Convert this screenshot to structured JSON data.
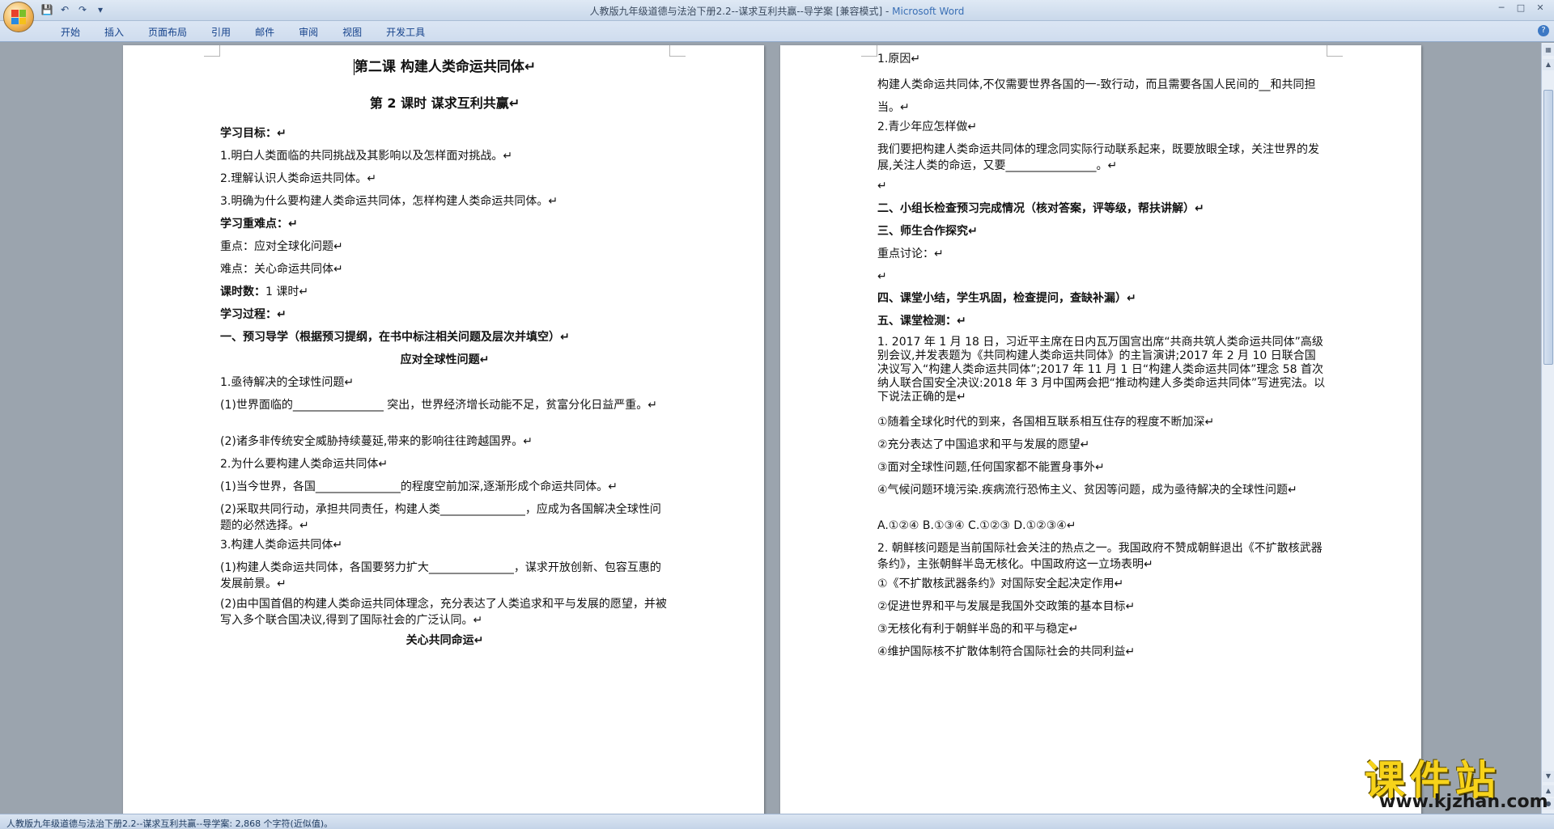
{
  "window": {
    "title": "人教版九年级道德与法治下册2.2--谋求互利共赢--导学案 [兼容模式] - ",
    "app_name": "Microsoft Word"
  },
  "ribbon": {
    "tabs": [
      "开始",
      "插入",
      "页面布局",
      "引用",
      "邮件",
      "审阅",
      "视图",
      "开发工具"
    ]
  },
  "left_page": {
    "lines": [
      "第二课   构建人类命运共同体↵",
      "第 2 课时     谋求互利共赢↵",
      "学习目标：↵",
      "1.明白人类面临的共同挑战及其影响以及怎样面对挑战。↵",
      "2.理解认识人类命运共同体。↵",
      "3.明确为什么要构建人类命运共同体，怎样构建人类命运共同体。↵",
      "学习重难点：↵",
      "重点：应对全球化问题↵",
      "难点：关心命运共同体↵",
      "课时数：",
      "1 课时↵",
      "学习过程：↵",
      "一、预习导学（根据预习提纲，在书中标注相关问题及层次并填空）↵",
      "应对全球性问题↵",
      "1.亟待解决的全球性问题↵",
      "(1)世界面临的________________  突出，世界经济增长动能不足，贫富分化日益严重。↵",
      "(2)诸多非传统安全威胁持续蔓延,带来的影响往往跨越国界。↵",
      "2.为什么要构建人类命运共同体↵",
      "(1)当今世界，各国_______________的程度空前加深,逐渐形成个命运共同体。↵",
      "(2)采取共同行动，承担共同责任，构建人类_______________，应成为各国解决全球性问题的必然选择。↵",
      "3.构建人类命运共同体↵",
      "(1)构建人类命运共同体，各国要努力扩大_______________，谋求开放创新、包容互惠的发展前景。↵",
      "(2)由中国首倡的构建人类命运共同体理念，充分表达了人类追求和平与发展的愿望，并被写入多个联合国决议,得到了国际社会的广泛认同。↵",
      "关心共同命运↵"
    ]
  },
  "right_page": {
    "lines": [
      "1.原因↵",
      "构建人类命运共同体,不仅需要世界各国的一-致行动，而且需要各国人民间的__和共同担当。↵",
      "2.青少年应怎样做↵",
      "我们要把构建人类命运共同体的理念同实际行动联系起来，既要放眼全球，关注世界的发展,关注人类的命运，又要________________。↵",
      "↵",
      "二、小组长检查预习完成情况（核对答案，评等级，帮扶讲解）↵",
      "三、师生合作探究↵",
      "重点讨论：↵",
      "↵",
      "四、课堂小结，学生巩固，检查提问，查缺补漏）↵",
      "五、课堂检测：↵",
      "1. 2017 年 1 月 18 日，习近平主席在日内瓦万国宫出席“共商共筑人类命运共同体”高级别会议,并发表题为《共同构建人类命运共同体》的主旨演讲;2017 年 2 月 10 日联合国决议写入“构建人类命运共同体”;2017 年 11 月 1 日“构建人类命运共同体”理念 58 首次纳人联合国安全决议:2018 年 3 月中国两会把“推动构建人多类命运共同体”写进宪法。以下说法正确的是↵",
      "①随着全球化时代的到来，各国相互联系相互住存的程度不断加深↵",
      "②充分表达了中国追求和平与发展的愿望↵",
      "③面对全球性问题,任何国家都不能置身事外↵",
      "④气候问题环境污染.疾病流行恐怖主义、贫因等问题，成为亟待解决的全球性问题↵",
      "A.①②④      B.①③④      C.①②③    D.①②③④↵",
      "2.  朝鲜核问题是当前国际社会关注的热点之一。我国政府不赞成朝鲜退出《不扩散核武器条约》，主张朝鲜半岛无核化。中国政府这一立场表明↵",
      "①《不扩散核武器条约》对国际安全起决定作用↵",
      "②促进世界和平与发展是我国外交政策的基本目标↵",
      "③无核化有利于朝鲜半岛的和平与稳定↵",
      "④维护国际核不扩散体制符合国际社会的共同利益↵"
    ]
  },
  "status_bar": {
    "text": "人教版九年级道德与法治下册2.2--谋求互利共赢--导学案: 2,868 个字符(近似值)。"
  },
  "watermark": {
    "brand": "课件站",
    "url": "www.kjzhan.com"
  }
}
